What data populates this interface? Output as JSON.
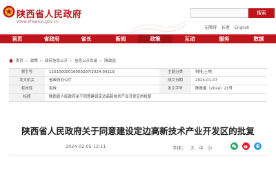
{
  "header": {
    "site_title": "陕西省人民政府",
    "site_url": "www.shaanxi.gov.cn",
    "search_placeholder": "",
    "search_button": "搜索",
    "util_links": [
      "无障碍",
      "长者",
      "English"
    ]
  },
  "nav": {
    "items": [
      "首页",
      "省政府",
      "省长",
      "新闻",
      "政策",
      "互动",
      "服务",
      "数据"
    ],
    "active_index": 4
  },
  "breadcrumb": {
    "items": [
      "首页",
      "政策",
      "政府信息公开",
      "信息公开目录",
      "陕政函"
    ]
  },
  "meta": {
    "rows": [
      {
        "label1": "索引号",
        "value1": "11610000016000297/2024-00119",
        "label2": "主题分类",
        "value2": "科技;土地"
      },
      {
        "label1": "发文机关",
        "value1": "省政府办公厅",
        "label2": "成文日期",
        "value2": "2024-01-07"
      },
      {
        "label1": "有效性",
        "value1": "有效",
        "label2": "发文字号",
        "value2": "陕政函〔2024〕21号"
      },
      {
        "label1": "标题",
        "value1": "陕西省人民政府关于同意建设定边高新技术产业开发区的批复",
        "label2": "",
        "value2": ""
      }
    ]
  },
  "article": {
    "title": "陕西省人民政府关于同意建设定边高新技术产业开发区的批复",
    "publish_date": "2024-02-05 12:11",
    "font_label": "字体：",
    "font_sizes": [
      "大",
      "中",
      "小"
    ]
  },
  "colors": {
    "brand_red": "#c0141b",
    "share_wechat": "#2aae67",
    "share_weibo": "#e6162d",
    "share_qq": "#2f9ee0"
  }
}
